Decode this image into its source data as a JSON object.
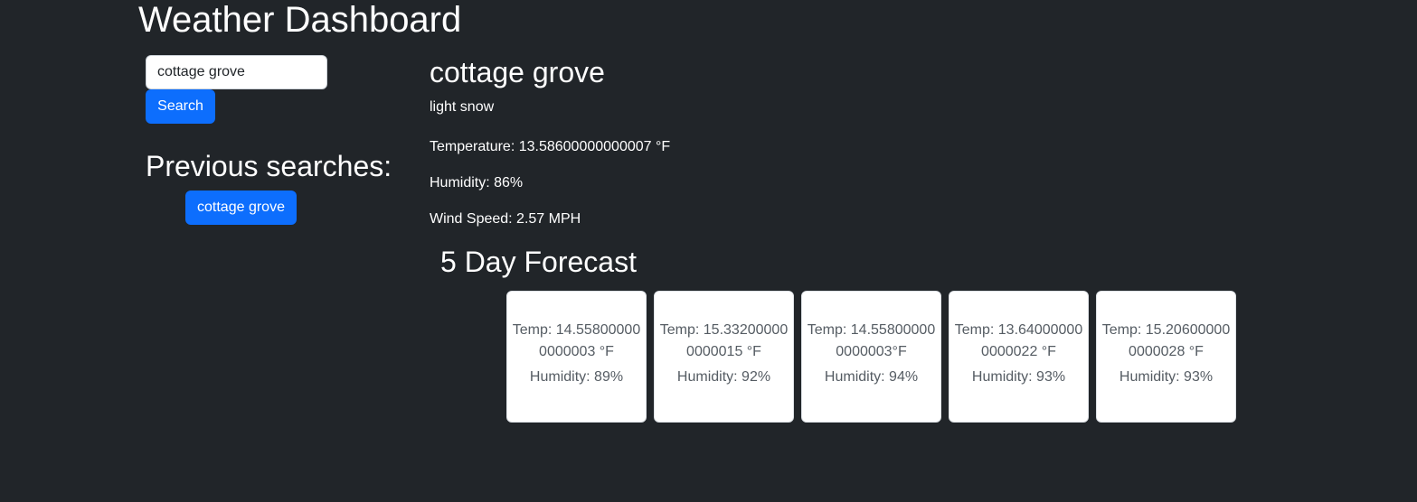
{
  "app": {
    "title": "Weather Dashboard"
  },
  "search": {
    "value": "cottage grove",
    "button_label": "Search"
  },
  "history": {
    "heading": "Previous searches:",
    "items": [
      "cottage grove"
    ]
  },
  "current": {
    "city": "cottage grove",
    "conditions": "light snow",
    "temperature": "Temperature: 13.58600000000007 °F",
    "humidity": "Humidity: 86%",
    "wind_speed": "Wind Speed: 2.57 MPH"
  },
  "forecast": {
    "heading": "5 Day Forecast",
    "days": [
      {
        "temp": "Temp: 14.558000000000003 °F",
        "humidity": "Humidity: 89%"
      },
      {
        "temp": "Temp: 15.332000000000015 °F",
        "humidity": "Humidity: 92%"
      },
      {
        "temp": "Temp: 14.558000000000003°F",
        "humidity": "Humidity: 94%"
      },
      {
        "temp": "Temp: 13.640000000000022 °F",
        "humidity": "Humidity: 93%"
      },
      {
        "temp": "Temp: 15.206000000000028 °F",
        "humidity": "Humidity: 93%"
      }
    ]
  },
  "colors": {
    "background": "#212529",
    "primary_button": "#0d6efd",
    "card_background": "#ffffff",
    "card_text": "#555c63"
  }
}
